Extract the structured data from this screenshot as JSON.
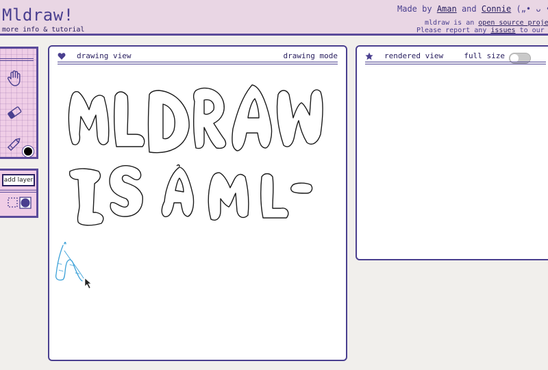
{
  "header": {
    "title": "Mldraw!",
    "subtitle": "more info & tutorial",
    "made_by": "Made by",
    "author1": "Aman",
    "and": "and",
    "author2": "Connie",
    "decoration": "(„• ᴗ •„",
    "oss_prefix": "mldraw is an",
    "oss_link": "open source project",
    "issues_prefix": "Please report any",
    "issues_link": "issues",
    "issues_suffix": "to our github"
  },
  "tools": {
    "items": [
      "hand-icon",
      "eraser-icon",
      "pencil-icon"
    ],
    "current_color": "#000000"
  },
  "layers": {
    "add_label": "add layer",
    "icons": [
      "selection-icon",
      "circle-icon"
    ]
  },
  "drawing_view": {
    "icon": "heart-icon",
    "title": "drawing view",
    "mode": "drawing mode"
  },
  "rendered_view": {
    "icon": "star-icon",
    "title": "rendered view",
    "toggle_label": "full size",
    "toggle_on": false
  },
  "colors": {
    "accent": "#4a3f8f",
    "header_bg": "#e9d6e4",
    "panel_pink": "#efcde6",
    "stroke_blue": "#3aa0d8"
  }
}
